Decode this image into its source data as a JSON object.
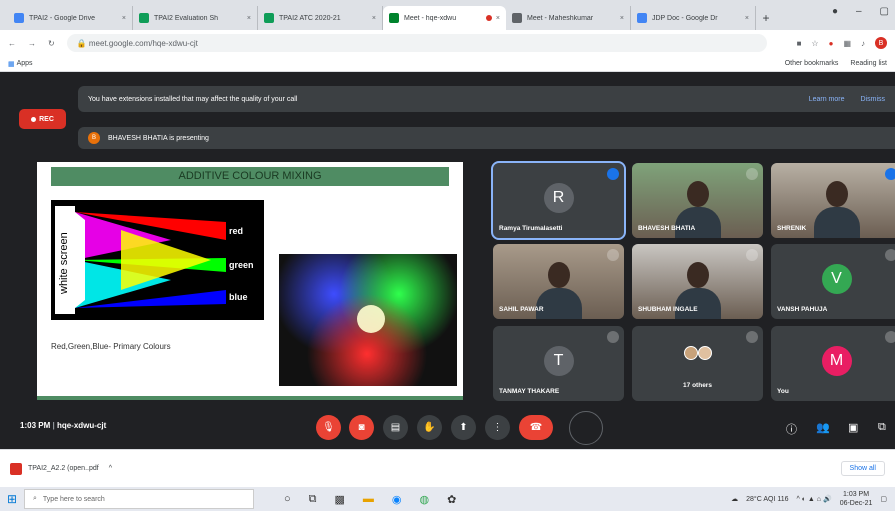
{
  "browser": {
    "tabs": [
      {
        "title": "TPAI2 - Google Drive",
        "color": "#4285f4"
      },
      {
        "title": "TPAI2 Evaluation Sh",
        "color": "#0f9d58"
      },
      {
        "title": "TPAI2 ATC 2020-21",
        "color": "#0f9d58"
      },
      {
        "title": "Meet - hqe-xdwu",
        "color": "#00832d",
        "active": true
      },
      {
        "title": "Meet - Maheshkumar",
        "color": "#5f6368"
      },
      {
        "title": "JDP Doc - Google Dr",
        "color": "#4285f4"
      }
    ],
    "new_tab": "+",
    "url": "meet.google.com/hqe-xdwu-cjt",
    "bookmarks_label": "Apps",
    "other_bookmarks": "Other bookmarks",
    "reading_list": "Reading list",
    "profile_initial": "B"
  },
  "meet": {
    "extension_warning": "You have extensions installed that may affect the quality of your call",
    "learn_more": "Learn more",
    "dismiss": "Dismiss",
    "rec_label": "REC",
    "presenter_initial": "B",
    "presenting_text": "BHAVESH BHATIA is presenting",
    "meeting_time": "1:03 PM",
    "meeting_code": "hqe-xdwu-cjt",
    "slide": {
      "title": "ADDITIVE COLOUR MIXING",
      "screen_label": "white screen",
      "red_label": "red",
      "green_label": "green",
      "blue_label": "blue",
      "caption": "Red,Green,Blue- Primary Colours"
    },
    "participants": [
      {
        "name": "Ramya Tirumalasetti",
        "initial": "R",
        "avatar_color": "#5f6368",
        "type": "avatar"
      },
      {
        "name": "BHAVESH BHATIA",
        "type": "photo",
        "photo_color": "#7fa37a"
      },
      {
        "name": "SHRENIK",
        "type": "photo",
        "photo_color": "#b8b0a4"
      },
      {
        "name": "SAHIL PAWAR",
        "type": "photo",
        "photo_color": "#a89a8a"
      },
      {
        "name": "SHUBHAM INGALE",
        "type": "photo",
        "photo_color": "#c9c6c2"
      },
      {
        "name": "VANSH PAHUJA",
        "initial": "V",
        "avatar_color": "#34a853",
        "type": "avatar"
      },
      {
        "name": "TANMAY THAKARE",
        "initial": "T",
        "avatar_color": "#5f6368",
        "type": "avatar"
      },
      {
        "name": "17 others",
        "type": "others"
      },
      {
        "name": "You",
        "initial": "M",
        "avatar_color": "#e91e63",
        "type": "avatar"
      }
    ]
  },
  "download_bar": {
    "file": "TPAI2_A2.2 (open..pdf",
    "show_all": "Show all"
  },
  "taskbar": {
    "search_placeholder": "Type here to search",
    "weather": "28°C AQI 116",
    "time": "1:03 PM",
    "date": "06-Dec-21"
  }
}
